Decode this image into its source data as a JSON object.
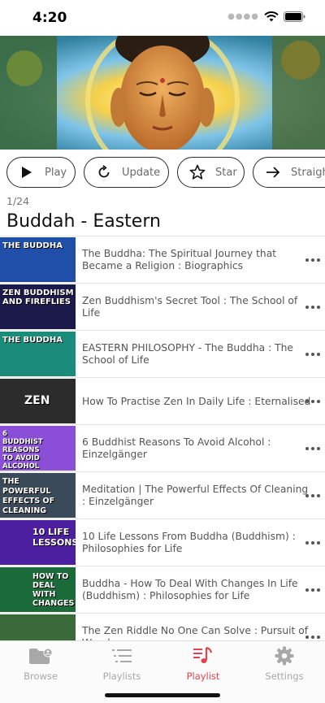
{
  "status": {
    "time": "4:20"
  },
  "buttons": [
    {
      "label": "Play",
      "icon": "play-icon"
    },
    {
      "label": "Update",
      "icon": "refresh-icon"
    },
    {
      "label": "Star",
      "icon": "star-icon"
    },
    {
      "label": "Straight",
      "icon": "arrow-right-icon"
    }
  ],
  "playlist": {
    "counter": "1/24",
    "title": "Buddah - Eastern",
    "items": [
      {
        "title": "The Buddha: The Spiritual Journey that Became a Religion : Biographics",
        "thumb_text": "THE BUDDHA",
        "thumb_color": "#1f4fa8"
      },
      {
        "title": "Zen Buddhism's Secret Tool : The School of Life",
        "thumb_text": "ZEN BUDDHISM AND FIREFLIES",
        "thumb_color": "#1b1a4a"
      },
      {
        "title": "EASTERN PHILOSOPHY - The Buddha : The School of Life",
        "thumb_text": "THE BUDDHA",
        "thumb_color": "#1c8c7a"
      },
      {
        "title": "How To Practise Zen In Daily Life : Eternalised",
        "thumb_text": "ZEN",
        "thumb_color": "#2c2c2c"
      },
      {
        "title": "6 Buddhist Reasons To Avoid Alcohol : Einzelgänger",
        "thumb_text": "6 BUDDHIST REASONS TO AVOID ALCOHOL",
        "thumb_color": "#8a4fd6"
      },
      {
        "title": "Meditation | The Powerful Effects Of Cleaning : Einzelgänger",
        "thumb_text": "THE POWERFUL EFFECTS OF CLEANING",
        "thumb_color": "#3a4a58"
      },
      {
        "title": "10 Life Lessons From Buddha (Buddhism) : Philosophies for Life",
        "thumb_text": "10 LIFE LESSONS",
        "thumb_color": "#4b1fa0"
      },
      {
        "title": "Buddha - How To Deal With Changes In Life (Buddhism) : Philosophies for Life",
        "thumb_text": "HOW TO DEAL WITH CHANGES",
        "thumb_color": "#1a6a3a"
      },
      {
        "title": "The Zen Riddle No One Can Solve : Pursuit of Wonder",
        "thumb_text": "",
        "thumb_color": "#3a6a3a"
      }
    ]
  },
  "tabs": [
    {
      "label": "Browse",
      "icon": "folder-icon"
    },
    {
      "label": "Playlists",
      "icon": "list-icon"
    },
    {
      "label": "Playlist",
      "icon": "music-note-icon"
    },
    {
      "label": "Settings",
      "icon": "gear-icon"
    }
  ],
  "colors": {
    "accent": "#e0454f",
    "inactive": "#a8a8a8"
  }
}
